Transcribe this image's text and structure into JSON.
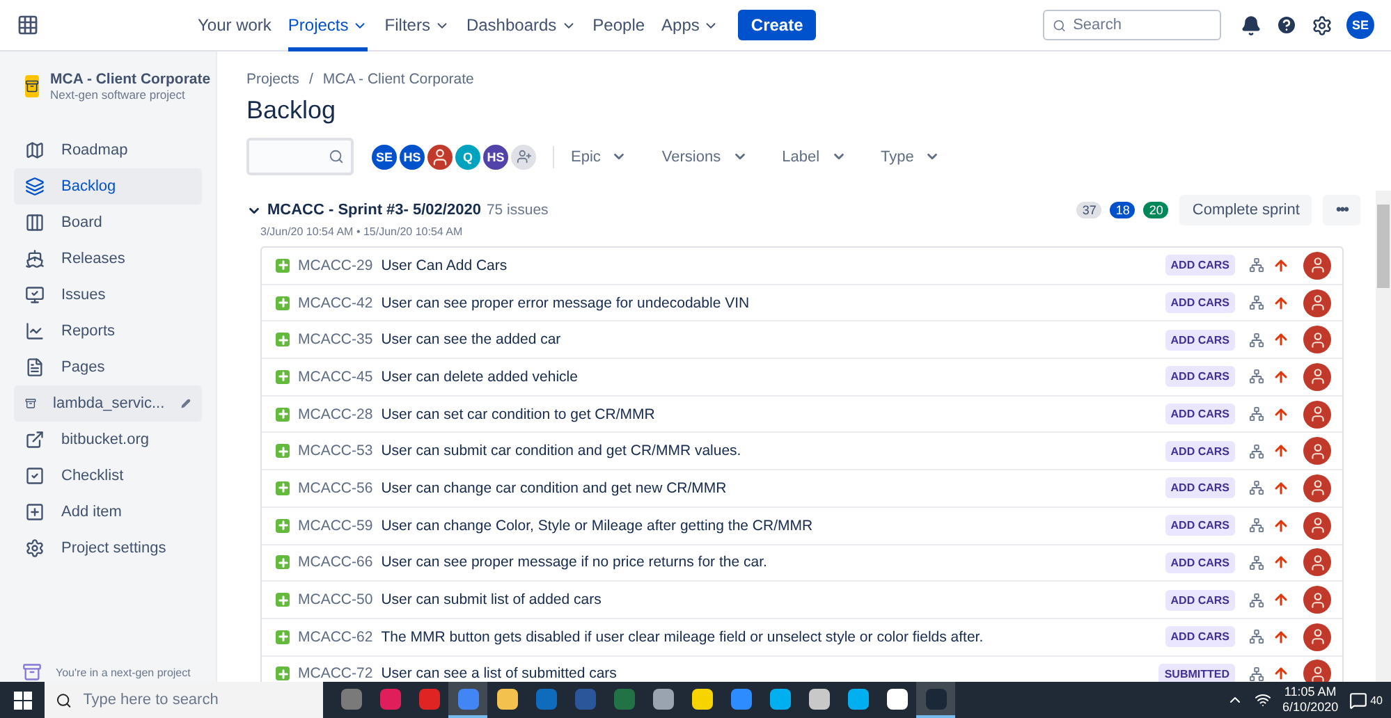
{
  "nav": {
    "items": [
      {
        "label": "Your work",
        "selected": false,
        "dropdown": false
      },
      {
        "label": "Projects",
        "selected": true,
        "dropdown": true
      },
      {
        "label": "Filters",
        "selected": false,
        "dropdown": true
      },
      {
        "label": "Dashboards",
        "selected": false,
        "dropdown": true
      },
      {
        "label": "People",
        "selected": false,
        "dropdown": false
      },
      {
        "label": "Apps",
        "selected": false,
        "dropdown": true
      }
    ],
    "create": "Create",
    "search": {
      "placeholder": "Search"
    },
    "avatar": "SE"
  },
  "sidebar": {
    "project": "MCA - Client Corporate",
    "subtitle": "Next-gen software project",
    "items": [
      {
        "label": "Roadmap",
        "selected": false,
        "hovered": false
      },
      {
        "label": "Backlog",
        "selected": true,
        "hovered": false
      },
      {
        "label": "Board",
        "selected": false,
        "hovered": false
      },
      {
        "label": "Releases",
        "selected": false,
        "hovered": false
      },
      {
        "label": "Issues",
        "selected": false,
        "hovered": false
      },
      {
        "label": "Reports",
        "selected": false,
        "hovered": false
      },
      {
        "label": "Pages",
        "selected": false,
        "hovered": false
      },
      {
        "label": "lambda_servic...",
        "selected": false,
        "hovered": true
      },
      {
        "label": "bitbucket.org",
        "selected": false,
        "hovered": false
      },
      {
        "label": "Checklist",
        "selected": false,
        "hovered": false
      },
      {
        "label": "Add item",
        "selected": false,
        "hovered": false
      },
      {
        "label": "Project settings",
        "selected": false,
        "hovered": false
      }
    ],
    "footer": "You're in a next-gen project"
  },
  "breadcrumbs": [
    "Projects",
    "MCA - Client Corporate"
  ],
  "breadcrumb_separator": "/",
  "title": "Backlog",
  "avatars": [
    {
      "kind": "initials",
      "initials": "SE",
      "color": "#0052cc"
    },
    {
      "kind": "initials",
      "initials": "HS",
      "color": "#0052cc"
    },
    {
      "kind": "photo",
      "color": "#c0392b"
    },
    {
      "kind": "initials",
      "initials": "Q",
      "color": "#00a3bf"
    },
    {
      "kind": "initials",
      "initials": "HS",
      "color": "#5243aa"
    },
    {
      "kind": "add",
      "color": "#dfe1e6"
    }
  ],
  "filters": [
    "Epic",
    "Versions",
    "Label",
    "Type"
  ],
  "sprint": {
    "name": "MCACC - Sprint #3- 5/02/2020",
    "count": "75 issues",
    "dates": "3/Jun/20 10:54 AM • 15/Jun/20 10:54 AM",
    "expanded": true,
    "badges": [
      {
        "value": "37",
        "color": "#dfe1e6"
      },
      {
        "value": "18",
        "color": "#0052cc"
      },
      {
        "value": "20",
        "color": "#00875a"
      }
    ],
    "complete": "Complete sprint",
    "more": "•••"
  },
  "issues": [
    {
      "key": "MCACC-29",
      "summary": "User Can Add Cars",
      "label": "ADD CARS"
    },
    {
      "key": "MCACC-42",
      "summary": "User can see proper error message for undecodable VIN",
      "label": "ADD CARS"
    },
    {
      "key": "MCACC-35",
      "summary": "User can see the added car",
      "label": "ADD CARS"
    },
    {
      "key": "MCACC-45",
      "summary": "User can delete added vehicle",
      "label": "ADD CARS"
    },
    {
      "key": "MCACC-28",
      "summary": "User can set car condition to get CR/MMR",
      "label": "ADD CARS"
    },
    {
      "key": "MCACC-53",
      "summary": "User can submit car condition and get CR/MMR values.",
      "label": "ADD CARS"
    },
    {
      "key": "MCACC-56",
      "summary": "User can change car condition and get new CR/MMR",
      "label": "ADD CARS"
    },
    {
      "key": "MCACC-59",
      "summary": "User can change Color, Style or Mileage after getting the CR/MMR",
      "label": "ADD CARS"
    },
    {
      "key": "MCACC-66",
      "summary": "User can see proper message if no price returns for the car.",
      "label": "ADD CARS"
    },
    {
      "key": "MCACC-50",
      "summary": "User can submit list of added cars",
      "label": "ADD CARS"
    },
    {
      "key": "MCACC-62",
      "summary": "The MMR button gets disabled if user clear mileage field or unselect style or color fields after.",
      "label": "ADD CARS"
    },
    {
      "key": "MCACC-72",
      "summary": "User can see a list of submitted cars",
      "label": "SUBMITTED"
    }
  ],
  "taskbar": {
    "search": {
      "placeholder": "Type here to search"
    },
    "apps": [
      {
        "color": "#7a7a7a",
        "active": false
      },
      {
        "color": "#e01e5a",
        "active": false
      },
      {
        "color": "#e02424",
        "active": false
      },
      {
        "color": "#4285f4",
        "active": true
      },
      {
        "color": "#f2c14e",
        "active": false
      },
      {
        "color": "#0f6cbd",
        "active": false
      },
      {
        "color": "#2b579a",
        "active": false
      },
      {
        "color": "#217346",
        "active": false
      },
      {
        "color": "#9aa4b1",
        "active": false
      },
      {
        "color": "#f7d400",
        "active": false
      },
      {
        "color": "#2d8cff",
        "active": false
      },
      {
        "color": "#00aff0",
        "active": false
      },
      {
        "color": "#c8c8c8",
        "active": false
      },
      {
        "color": "#00aff0",
        "active": false
      },
      {
        "color": "#ffffff",
        "active": false
      },
      {
        "color": "#1b2838",
        "active": true
      }
    ],
    "time": "11:05 AM",
    "date": "6/10/2020",
    "notifications": "40"
  }
}
